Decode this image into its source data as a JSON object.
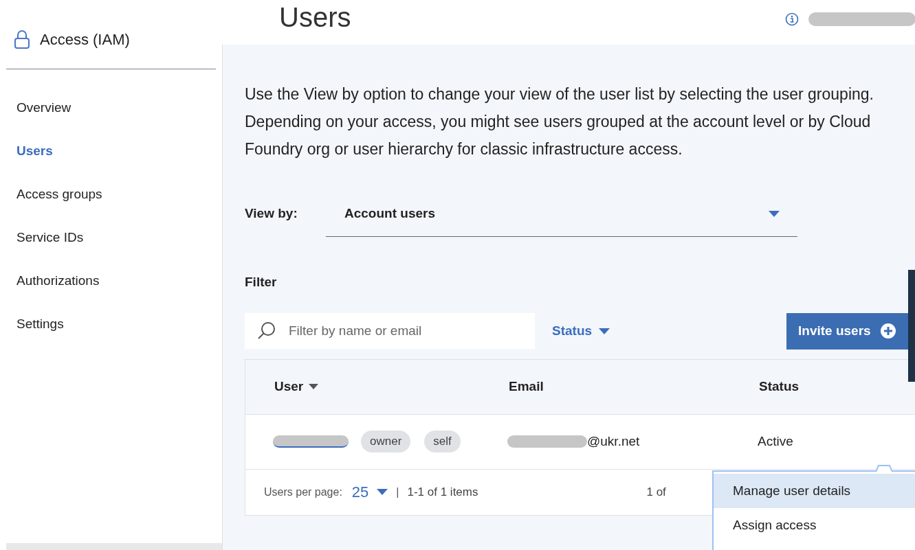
{
  "sidebar": {
    "title": "Access (IAM)",
    "items": [
      {
        "label": "Overview",
        "selected": false
      },
      {
        "label": "Users",
        "selected": true
      },
      {
        "label": "Access groups",
        "selected": false
      },
      {
        "label": "Service IDs",
        "selected": false
      },
      {
        "label": "Authorizations",
        "selected": false
      },
      {
        "label": "Settings",
        "selected": false
      }
    ]
  },
  "page_title": "Users",
  "description": "Use the View by option to change your view of the user list by selecting the user grouping. Depending on your access, you might see users grouped at the account level or by Cloud Foundry org or user hierarchy for classic infrastructure access.",
  "view_by": {
    "label": "View by:",
    "value": "Account users"
  },
  "filter": {
    "label": "Filter",
    "search_placeholder": "Filter by name or email",
    "status_label": "Status",
    "invite_button": "Invite users"
  },
  "table": {
    "columns": [
      "User",
      "Email",
      "Status"
    ],
    "rows": [
      {
        "tags": [
          "owner",
          "self"
        ],
        "email": "@ukr.net",
        "status": "Active"
      }
    ],
    "footer": {
      "per_page_label": "Users per page:",
      "per_page": "25",
      "separator": "|",
      "range": "1-1 of 1 items",
      "pages": "1 of"
    }
  },
  "menu": [
    {
      "label": "Manage user details",
      "selected": true
    },
    {
      "label": "Assign access",
      "selected": false
    }
  ]
}
